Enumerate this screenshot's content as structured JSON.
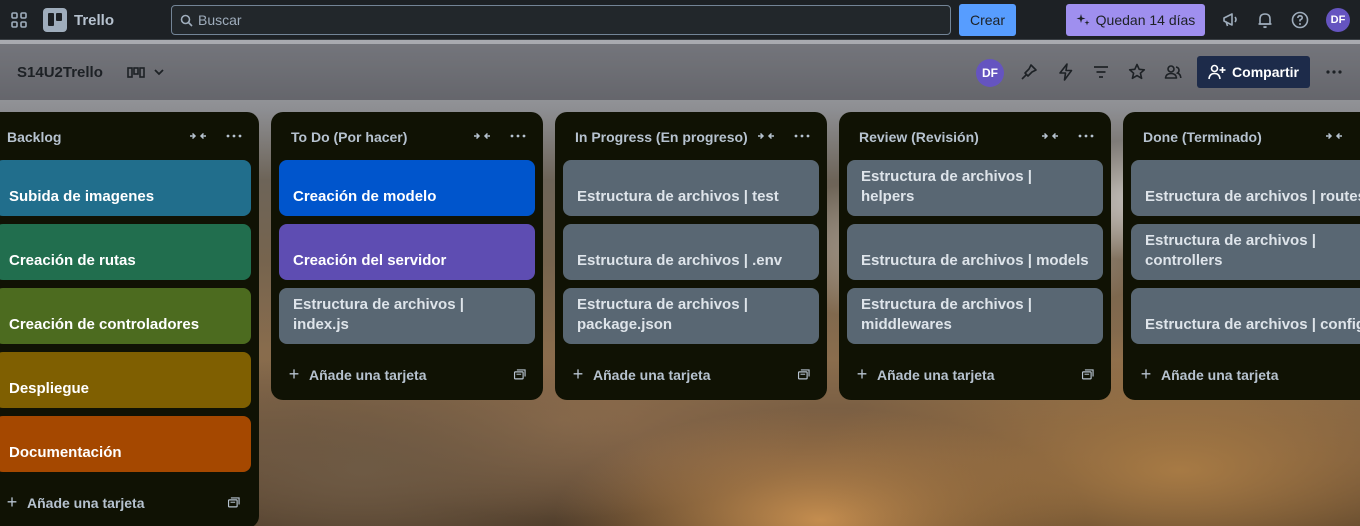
{
  "app": {
    "name": "Trello"
  },
  "search": {
    "placeholder": "Buscar"
  },
  "topbar": {
    "create_label": "Crear",
    "trial_label": "Quedan 14 días",
    "avatar_initials": "DF"
  },
  "board": {
    "title": "S14U2Trello",
    "member_initials": "DF",
    "share_label": "Compartir"
  },
  "add_card_label": "Añade una tarjeta",
  "lists": [
    {
      "title": "Backlog",
      "cards": [
        {
          "title": "Subida de imagenes",
          "color": "#216e8c"
        },
        {
          "title": "Creación de rutas",
          "color": "#216e4e"
        },
        {
          "title": "Creación de controladores",
          "color": "#4c6b1f"
        },
        {
          "title": "Despliegue",
          "color": "#7f5f01"
        },
        {
          "title": "Documentación",
          "color": "#a54800"
        }
      ]
    },
    {
      "title": "To Do (Por hacer)",
      "cards": [
        {
          "title": "Creación de modelo",
          "color": "#0055cc"
        },
        {
          "title": "Creación del servidor",
          "color": "#5e4db2"
        },
        {
          "title": "Estructura de archivos | index.js",
          "color": "#596773"
        }
      ]
    },
    {
      "title": "In Progress (En progreso)",
      "cards": [
        {
          "title": "Estructura de archivos | test",
          "color": "#596773"
        },
        {
          "title": "Estructura de archivos | .env",
          "color": "#596773"
        },
        {
          "title": "Estructura de archivos | package.json",
          "color": "#596773"
        }
      ]
    },
    {
      "title": "Review (Revisión)",
      "cards": [
        {
          "title": "Estructura de archivos | helpers",
          "color": "#596773"
        },
        {
          "title": "Estructura de archivos | models",
          "color": "#596773"
        },
        {
          "title": "Estructura de archivos | middlewares",
          "color": "#596773"
        }
      ]
    },
    {
      "title": "Done (Terminado)",
      "cards": [
        {
          "title": "Estructura de archivos | routes",
          "color": "#596773"
        },
        {
          "title": "Estructura de archivos | controllers",
          "color": "#596773"
        },
        {
          "title": "Estructura de archivos | config",
          "color": "#596773"
        }
      ]
    }
  ]
}
